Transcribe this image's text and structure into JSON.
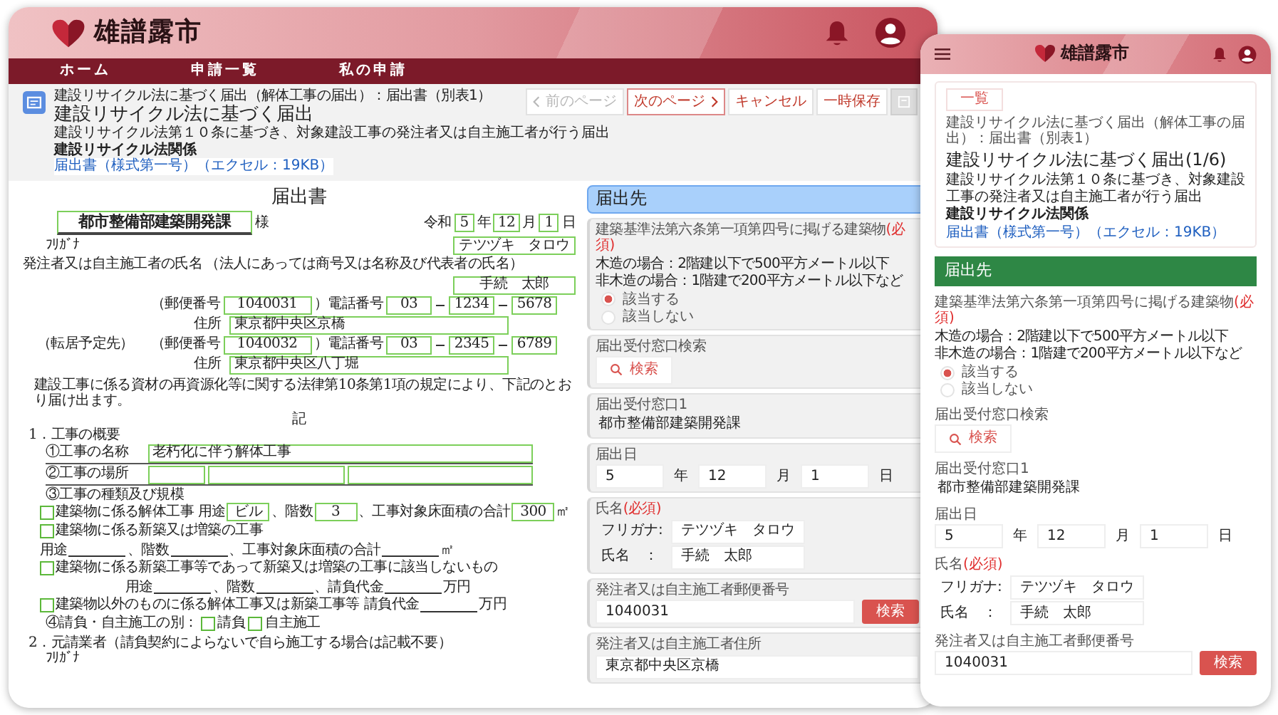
{
  "desktop": {
    "logo": "雄譜露市",
    "nav": [
      "ホーム",
      "申請一覧",
      "私の申請"
    ],
    "breadcrumb": "建設リサイクル法に基づく届出（解体工事の届出）：届出書（別表1）",
    "title": "建設リサイクル法に基づく届出",
    "description": "建設リサイクル法第１０条に基づき、対象建設工事の発注者又は自主施工者が行う届出",
    "category": "建設リサイクル法関係",
    "link": "届出書（様式第一号）（エクセル：19KB）",
    "toolbar": [
      {
        "kind": "prev",
        "label": "前のページ",
        "disabled": true
      },
      {
        "kind": "next",
        "label": "次のページ",
        "disabled": false
      },
      {
        "kind": "plain",
        "label": "キャンセル",
        "disabled": false
      },
      {
        "kind": "plain",
        "label": "一時保存",
        "disabled": false
      },
      {
        "kind": "icon",
        "disabled": true
      }
    ],
    "document": {
      "title": "届出書",
      "addressee": "都市整備部建築開発課",
      "honorific": "様",
      "era": "令和",
      "date": [
        {
          "value": "5",
          "unit": "年"
        },
        {
          "value": "12",
          "unit": "月"
        },
        {
          "value": "1",
          "unit": "日"
        }
      ],
      "furigana_label": "ﾌﾘｶﾞﾅ",
      "furigana": "テツヅキ　タロウ",
      "name_label": "発注者又は自主施工者の氏名",
      "name_note": "（法人にあっては商号又は名称及び代表者の氏名）",
      "name": "手続　太郎",
      "contacts": [
        {
          "postal_label": "（郵便番号",
          "postal": "1040031",
          "phone_label": "）電話番号",
          "phone": [
            "03",
            "1234",
            "5678"
          ],
          "address_label": "住所",
          "address": "東京都中央区京橋"
        },
        {
          "prefix": "（転居予定先）",
          "postal_label": "（郵便番号",
          "postal": "1040032",
          "phone_label": "）電話番号",
          "phone": [
            "03",
            "2345",
            "6789"
          ],
          "address_label": "住所",
          "address": "東京都中央区八丁堀"
        }
      ],
      "statement": "建設工事に係る資材の再資源化等に関する法律第10条第1項の規定により、下記のとおり届け出ます。",
      "note_heading": "記",
      "section1": "1．工事の概要",
      "items": [
        {
          "kind": "single",
          "label": "①工事の名称",
          "value": "老朽化に伴う解体工事"
        },
        {
          "kind": "split",
          "label": "②工事の場所"
        }
      ],
      "item3": "③工事の種類及び規模",
      "works": [
        {
          "kind": "inline",
          "checked": false,
          "label": "建築物に係る解体工事",
          "parts": [
            {
              "text": "用途",
              "field": "ビル"
            },
            {
              "text": "、階数",
              "field": "3"
            },
            {
              "text": "、工事対象床面積の合計",
              "field": "300"
            },
            {
              "text": "㎡"
            }
          ]
        },
        {
          "kind": "inline",
          "checked": false,
          "label": "建築物に係る新築又は増築の工事",
          "parts": [
            {
              "text": "用途",
              "blank": true
            },
            {
              "text": "、階数",
              "blank": true
            },
            {
              "text": "、工事対象床面積の合計",
              "blank": true
            },
            {
              "text": "㎡"
            }
          ]
        },
        {
          "kind": "stacked",
          "checked": false,
          "label": "建築物に係る新築工事等であって新築又は増築の工事に該当しないもの",
          "parts": [
            {
              "text": "用途",
              "blank": true
            },
            {
              "text": "、階数",
              "blank": true
            },
            {
              "text": "、請負代金",
              "blank": true
            },
            {
              "text": "万円"
            }
          ]
        },
        {
          "kind": "inline",
          "checked": false,
          "label": "建築物以外のものに係る解体工事又は新築工事等",
          "parts": [
            {
              "text": "請負代金",
              "blank": true
            },
            {
              "text": "万円"
            }
          ]
        }
      ],
      "contract": {
        "label": "④請負・自主施工の別：",
        "options": [
          {
            "label": "請負",
            "checked": false
          },
          {
            "label": "自主施工",
            "checked": false
          }
        ]
      },
      "section2": "2．元請業者（請負契約によらないで自ら施工する場合は記載不要）",
      "furigana2": "ﾌﾘｶﾞﾅ"
    },
    "form": {
      "title": "届出先",
      "fields": [
        {
          "kind": "radio",
          "label": "建築基準法第六条第一項第四号に掲げる建築物",
          "required": "(必須)",
          "notes": [
            "木造の場合：2階建以下で500平方メートル以下",
            "非木造の場合：1階建で200平方メートル以下など"
          ],
          "options": [
            {
              "label": "該当する",
              "selected": true
            },
            {
              "label": "該当しない",
              "selected": false
            }
          ]
        },
        {
          "kind": "search",
          "label": "届出受付窓口検索",
          "button": "検索"
        },
        {
          "kind": "value",
          "label": "届出受付窓口1",
          "value": "都市整備部建築開発課"
        },
        {
          "kind": "date",
          "label": "届出日",
          "parts": [
            {
              "value": "5",
              "unit": "年"
            },
            {
              "value": "12",
              "unit": "月"
            },
            {
              "value": "1",
              "unit": "日"
            }
          ]
        },
        {
          "kind": "name",
          "label": "氏名",
          "required": "(必須)",
          "rows": [
            {
              "label": "フリガナ:",
              "value": "テツヅキ　タロウ"
            },
            {
              "label": "氏名　：",
              "value": "手続　太郎"
            }
          ]
        },
        {
          "kind": "postal",
          "label": "発注者又は自主施工者郵便番号",
          "value": "1040031",
          "button": "検索"
        },
        {
          "kind": "address",
          "label": "発注者又は自主施工者住所",
          "value": "東京都中央区京橋"
        }
      ]
    }
  },
  "mobile": {
    "logo": "雄譜露市",
    "back": "一覧",
    "breadcrumb": "建設リサイクル法に基づく届出（解体工事の届出）：届出書（別表1）",
    "title": "建設リサイクル法に基づく届出(1/6)",
    "description": "建設リサイクル法第１０条に基づき、対象建設工事の発注者又は自主施工者が行う届出",
    "category": "建設リサイクル法関係",
    "link": "届出書（様式第一号）（エクセル：19KB）",
    "form": {
      "title": "届出先",
      "fields": [
        {
          "kind": "radio",
          "label": "建築基準法第六条第一項第四号に掲げる建築物",
          "required": "(必須)",
          "notes": [
            "木造の場合：2階建以下で500平方メートル以下",
            "非木造の場合：1階建で200平方メートル以下など"
          ],
          "options": [
            {
              "label": "該当する",
              "selected": true
            },
            {
              "label": "該当しない",
              "selected": false
            }
          ]
        },
        {
          "kind": "search",
          "label": "届出受付窓口検索",
          "button": "検索"
        },
        {
          "kind": "value",
          "label": "届出受付窓口1",
          "value": "都市整備部建築開発課"
        },
        {
          "kind": "date",
          "label": "届出日",
          "parts": [
            {
              "value": "5",
              "unit": "年"
            },
            {
              "value": "12",
              "unit": "月"
            },
            {
              "value": "1",
              "unit": "日"
            }
          ]
        },
        {
          "kind": "name",
          "label": "氏名",
          "required": "(必須)",
          "rows": [
            {
              "label": "フリガナ:",
              "value": "テツヅキ　タロウ"
            },
            {
              "label": "氏名　：",
              "value": "手続　太郎"
            }
          ]
        },
        {
          "kind": "postal",
          "label": "発注者又は自主施工者郵便番号",
          "value": "1040031",
          "button": "検索"
        }
      ]
    }
  }
}
